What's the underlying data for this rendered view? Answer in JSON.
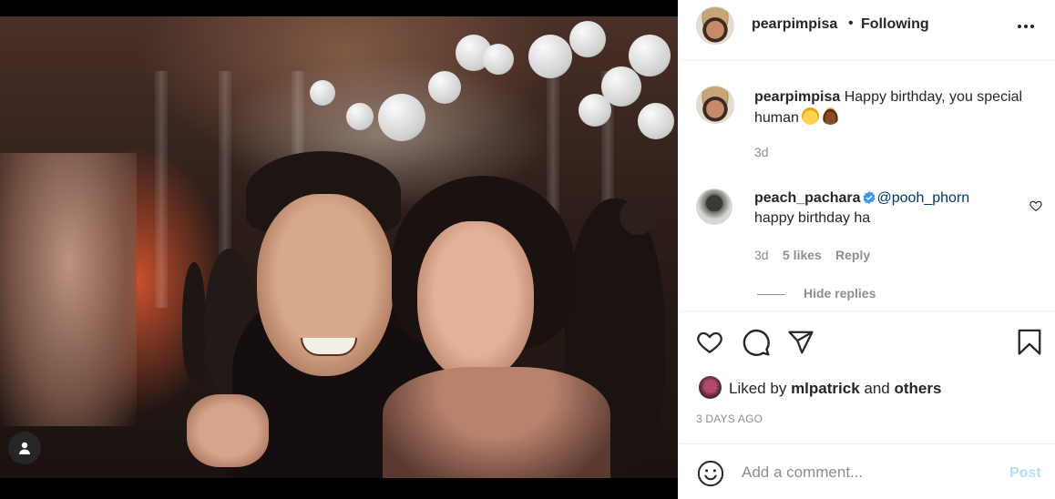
{
  "post": {
    "author": "pearpimpisa",
    "follow_status": "Following",
    "separator": "•",
    "menu_icon": "more-horizontal-icon"
  },
  "caption": {
    "username": "pearpimpisa",
    "text": "Happy birthday, you special human",
    "emojis": [
      "face-with-party-hat-emoji",
      "pancakes-emoji"
    ],
    "time": "3d"
  },
  "comment": {
    "username": "peach_pachara",
    "verified": true,
    "mention": "@pooh_phorn",
    "text": "happy birthday ha",
    "time": "3d",
    "likes": "5 likes",
    "reply_label": "Reply",
    "hide_replies_label": "Hide replies"
  },
  "actions": {
    "icons": [
      "heart-icon",
      "comment-icon",
      "share-icon",
      "bookmark-icon"
    ],
    "liked_by_prefix": "Liked by",
    "liked_by_user": "mlpatrick",
    "liked_by_and": "and",
    "liked_by_others": "others",
    "date": "3 DAYS AGO"
  },
  "add_comment": {
    "placeholder": "Add a comment...",
    "post_label": "Post",
    "emoji_icon": "smiley-icon"
  },
  "colors": {
    "text": "#262626",
    "muted": "#8e8e8e",
    "mention": "#00376b",
    "verified": "#3897f0",
    "post_disabled": "#b2dffc"
  }
}
